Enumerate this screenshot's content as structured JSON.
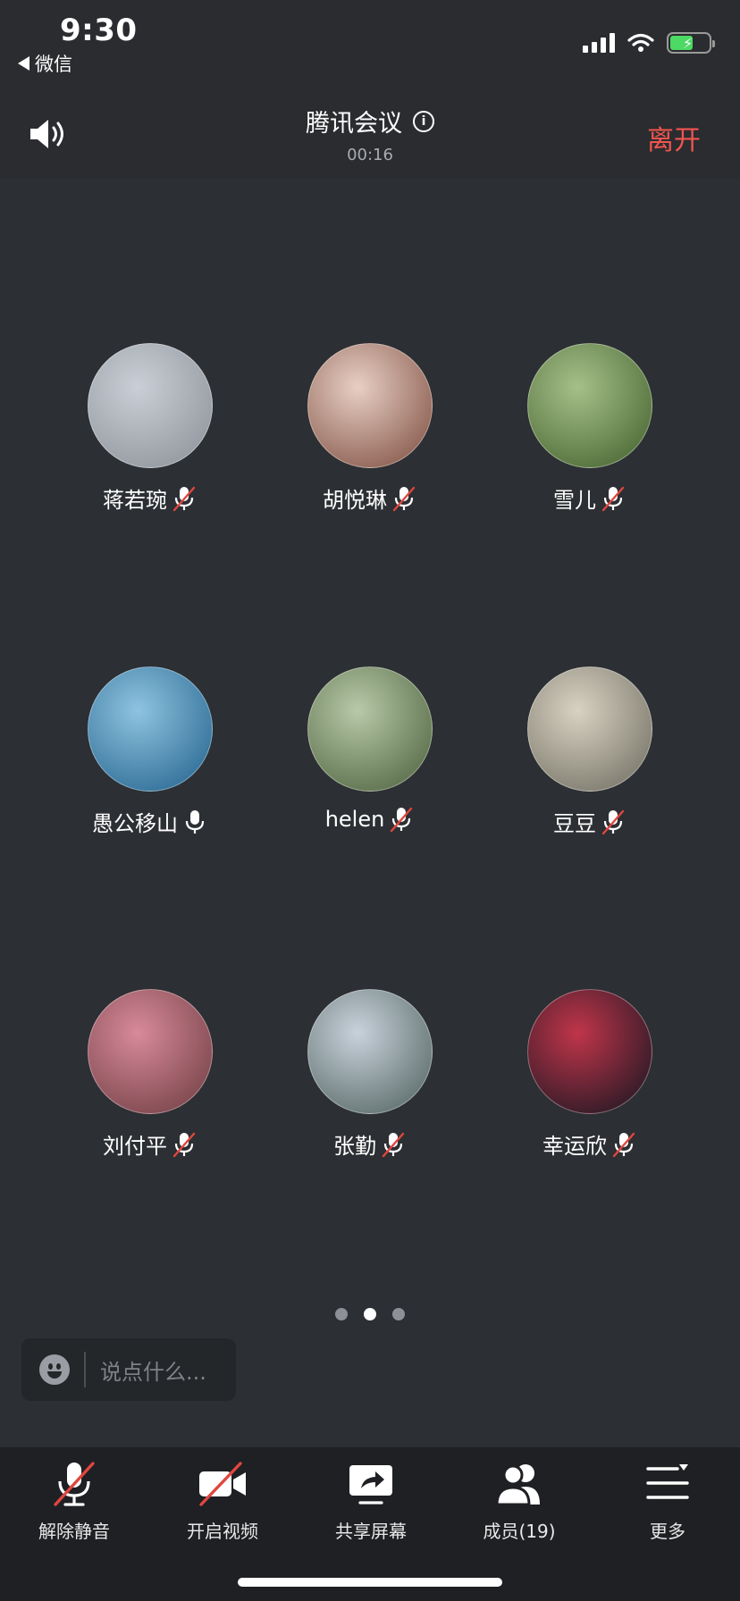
{
  "status_bar": {
    "time": "9:30",
    "back_app": "微信"
  },
  "header": {
    "title": "腾讯会议",
    "timer": "00:16",
    "leave_label": "离开"
  },
  "participants": [
    {
      "name": "蒋若琬",
      "muted": true,
      "avatar_colors": [
        "#c9cfd6",
        "#8a8f96"
      ]
    },
    {
      "name": "胡悦琳",
      "muted": true,
      "avatar_colors": [
        "#e8cfc4",
        "#7a4a3c"
      ]
    },
    {
      "name": "雪儿",
      "muted": true,
      "avatar_colors": [
        "#a7c08a",
        "#3f5e2a"
      ]
    },
    {
      "name": "愚公移山",
      "muted": false,
      "avatar_colors": [
        "#8fc3e0",
        "#1f5f8a"
      ]
    },
    {
      "name": "helen",
      "muted": true,
      "avatar_colors": [
        "#b7c9a8",
        "#4a5e3a"
      ]
    },
    {
      "name": "豆豆",
      "muted": true,
      "avatar_colors": [
        "#d9d2c2",
        "#6b6a5e"
      ]
    },
    {
      "name": "刘付平",
      "muted": true,
      "avatar_colors": [
        "#d88a9a",
        "#6a3a3e"
      ]
    },
    {
      "name": "张勤",
      "muted": true,
      "avatar_colors": [
        "#c8d2dc",
        "#4d5e5a"
      ]
    },
    {
      "name": "幸运欣",
      "muted": true,
      "avatar_colors": [
        "#c0354a",
        "#101520"
      ]
    }
  ],
  "pagination": {
    "current": 2,
    "total": 3
  },
  "chat": {
    "placeholder": "说点什么..."
  },
  "toolbar": [
    {
      "label": "解除静音",
      "icon": "mic-muted-icon"
    },
    {
      "label": "开启视频",
      "icon": "video-off-icon"
    },
    {
      "label": "共享屏幕",
      "icon": "share-screen-icon"
    },
    {
      "label": "成员(19)",
      "icon": "members-icon"
    },
    {
      "label": "更多",
      "icon": "more-icon"
    }
  ],
  "colors": {
    "background": "#2c2f33",
    "header": "#2a2c2f",
    "toolbar": "#1e2023",
    "leave": "#f0554f",
    "mute_slash": "#e0463f"
  }
}
